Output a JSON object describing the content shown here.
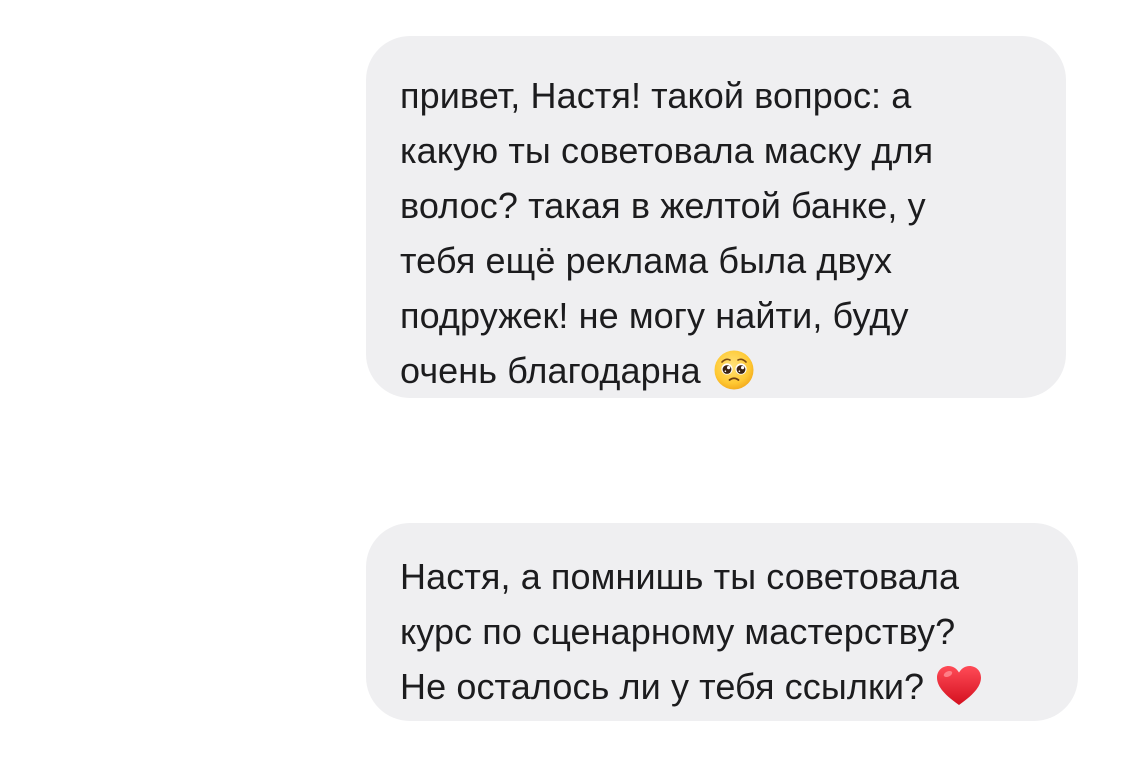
{
  "messages": [
    {
      "lines": [
        "привет, Настя! такой вопрос: а",
        "какую ты советовала маску для",
        "волос? такая в желтой банке, у",
        "тебя ещё реклама была двух",
        "подружек! не могу найти, буду",
        "очень благодарна"
      ],
      "emoji": "pleading-face-icon"
    },
    {
      "lines": [
        "Настя, а помнишь ты советовала",
        "курс по сценарному мастерству?",
        "Не осталось ли у тебя ссылки?"
      ],
      "emoji": "red-heart-icon"
    }
  ],
  "colors": {
    "bubble_background": "#efeff1",
    "text": "#1c1c1e",
    "heart": "#e0212e",
    "emoji_face": "#ffcc33"
  }
}
